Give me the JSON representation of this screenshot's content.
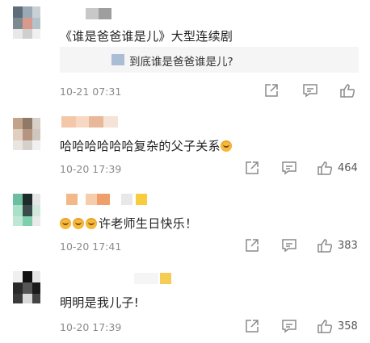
{
  "comments": [
    {
      "text": "《谁是爸爸谁是儿》大型连续剧",
      "quote": "到底谁是爸爸谁是儿?",
      "time": "10-21 07:31",
      "likes": ""
    },
    {
      "text": "哈哈哈哈哈哈复杂的父子关系",
      "time": "10-20 17:39",
      "likes": "464"
    },
    {
      "text": "许老师生日快乐！",
      "time": "10-20 17:41",
      "likes": "383"
    },
    {
      "text": "明明是我儿子!",
      "time": "10-20 17:39",
      "likes": "358"
    }
  ],
  "icons": {
    "share": "share-icon",
    "comment": "comment-icon",
    "like": "thumbs-up-icon",
    "emoji": "laughing-emoji-icon"
  }
}
